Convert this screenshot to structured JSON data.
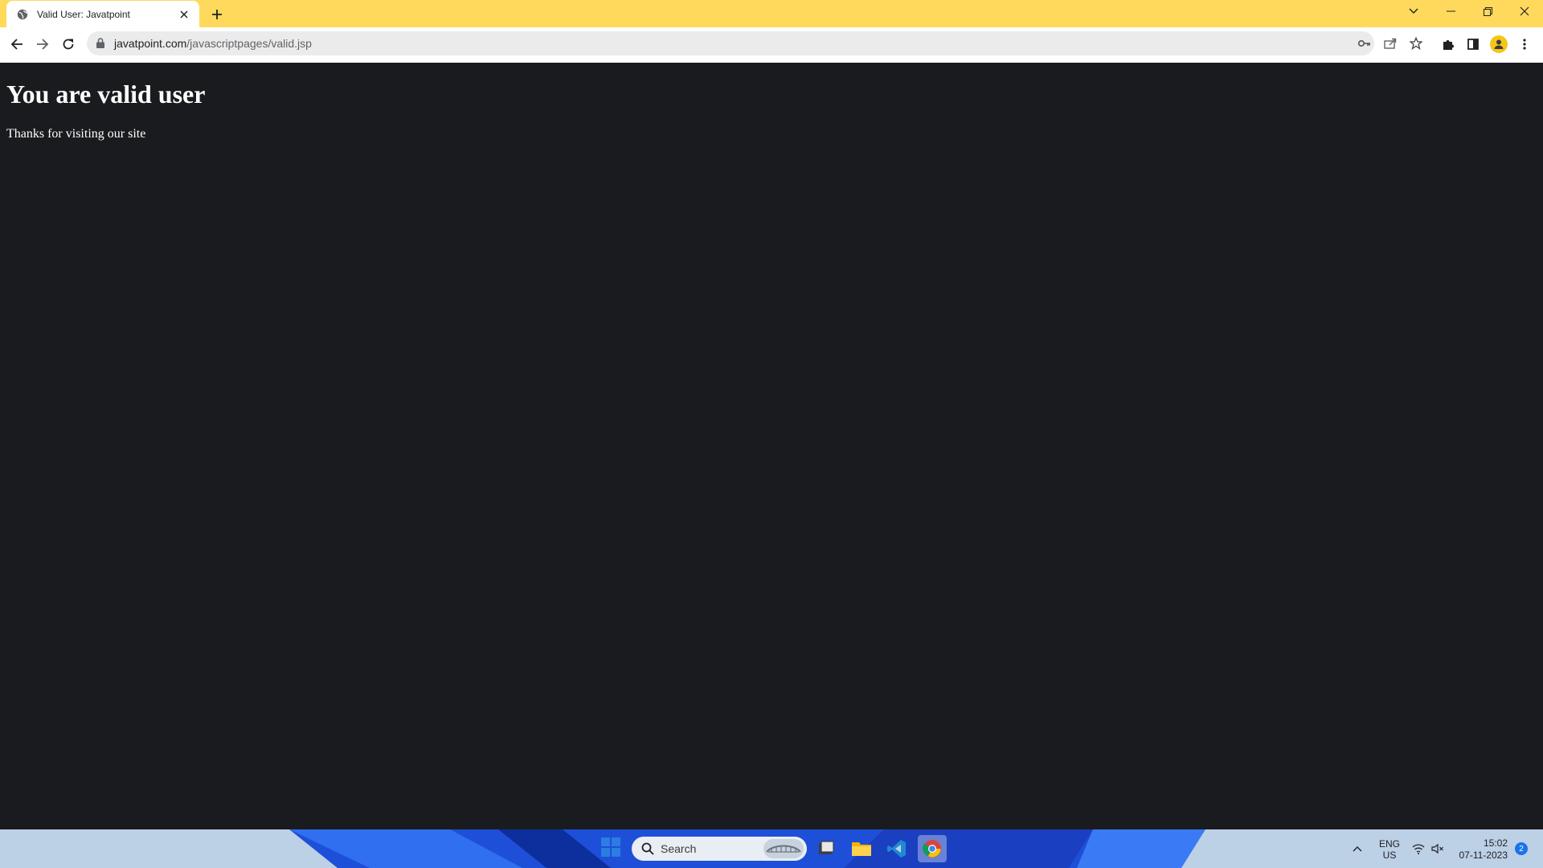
{
  "browser": {
    "tab": {
      "title": "Valid User: Javatpoint"
    },
    "address_bar": {
      "domain": "javatpoint.com",
      "path": "/javascriptpages/valid.jsp"
    },
    "theme_color": "#fed95c",
    "icons": {
      "tab_favicon": "globe-icon",
      "new_tab": "plus-icon",
      "tab_search": "chevron-down-icon",
      "minimize": "minimize-icon",
      "restore": "restore-icon",
      "close": "close-icon",
      "back": "back-arrow-icon",
      "forward": "forward-arrow-icon",
      "reload": "reload-icon",
      "site_info": "lock-icon",
      "password": "key-icon",
      "share": "share-icon",
      "bookmark": "star-icon",
      "extensions": "puzzle-icon",
      "side_panel": "side-panel-icon",
      "profile": "profile-icon",
      "menu": "kebab-menu-icon"
    }
  },
  "page": {
    "heading": "You are valid user",
    "message": "Thanks for visiting our site",
    "background": "#1a1b1e",
    "text_color": "#ffffff"
  },
  "taskbar": {
    "search_label": "Search",
    "apps": [
      "windows-start-icon",
      "task-view-icon",
      "file-explorer-icon",
      "vscode-icon",
      "chrome-icon"
    ],
    "language": {
      "line1": "ENG",
      "line2": "US"
    },
    "time": "15:02",
    "date": "07-11-2023",
    "notification_count": "2"
  }
}
